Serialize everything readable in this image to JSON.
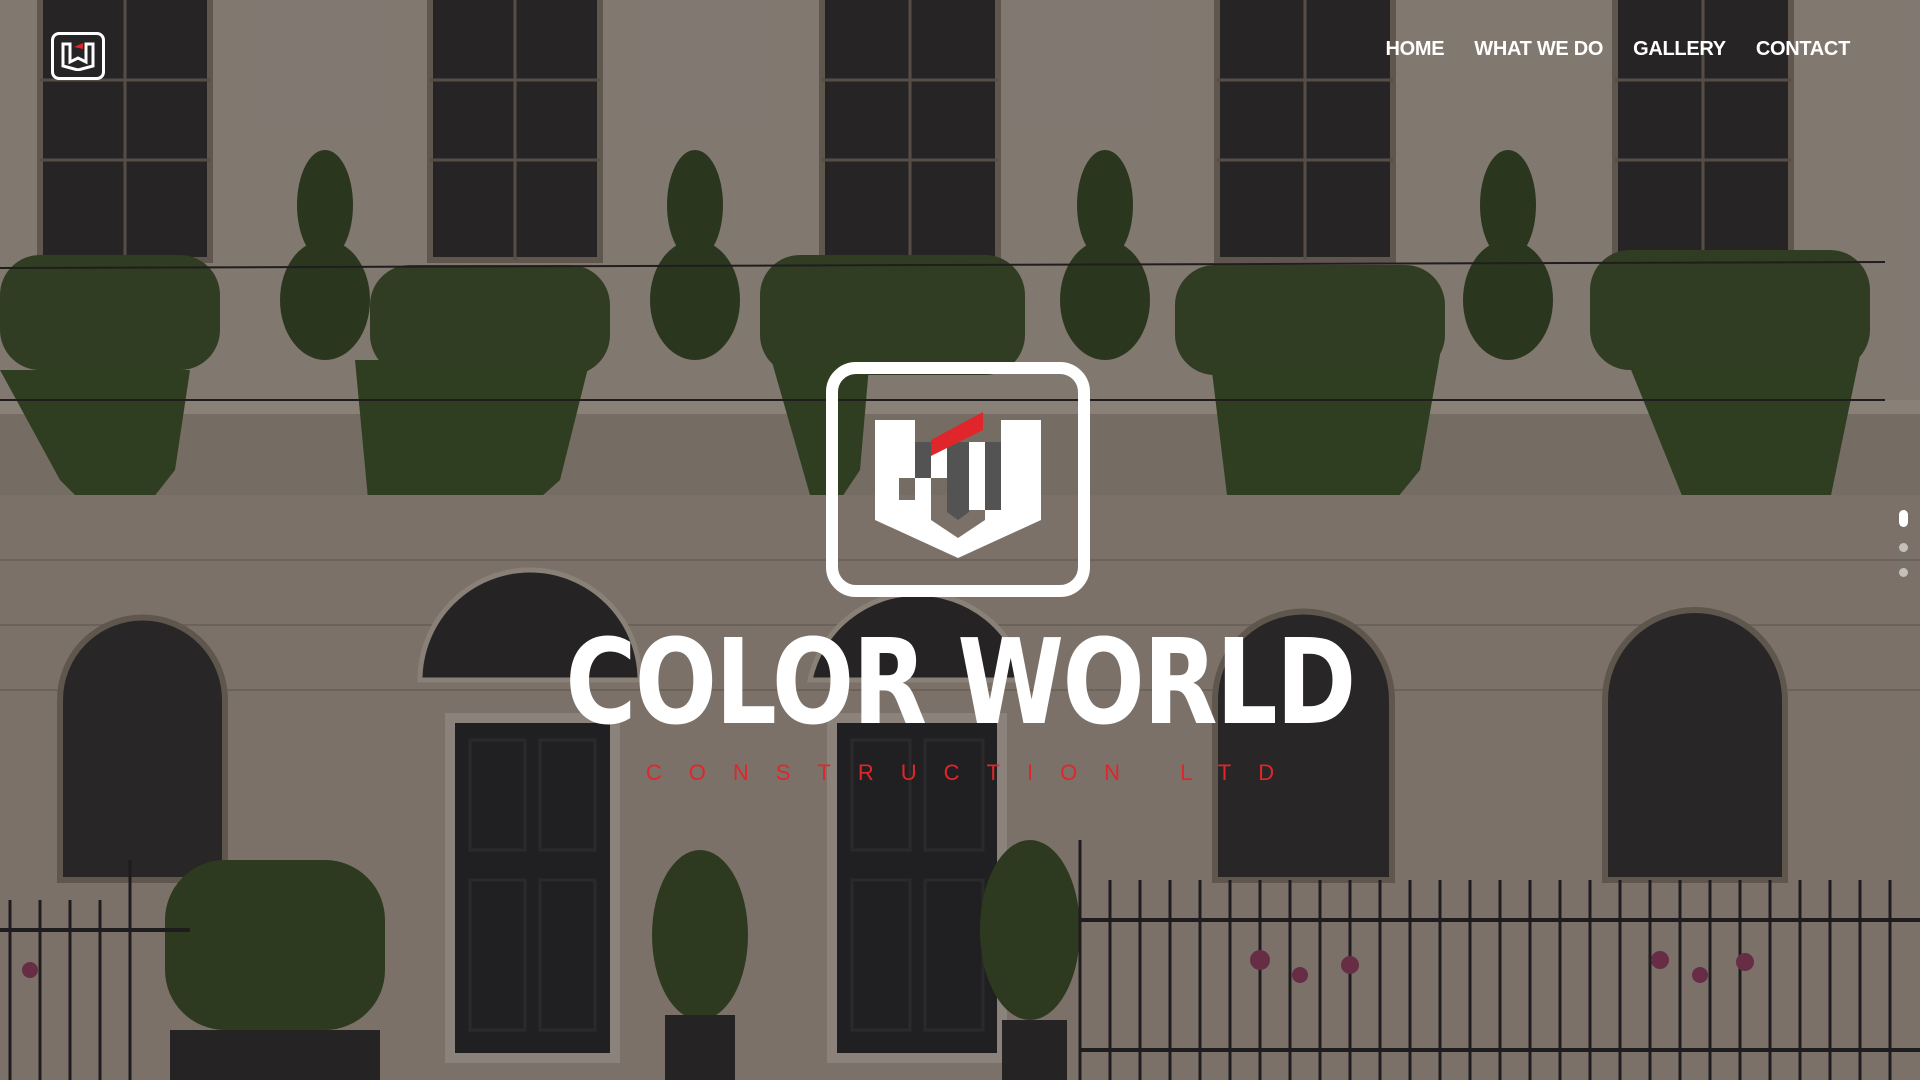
{
  "nav": {
    "items": [
      {
        "label": "HOME"
      },
      {
        "label": "WHAT WE DO"
      },
      {
        "label": "GALLERY"
      },
      {
        "label": "CONTACT"
      }
    ]
  },
  "brand": {
    "name": "COLOR WORLD",
    "tagline": "CONSTRUCTION LTD",
    "logo_icon": "cw-logo-icon",
    "accent_color": "#e0262b"
  },
  "slider": {
    "total_slides": 3,
    "active_slide": 1
  },
  "background": {
    "icon": "georgian-townhouse-facade"
  }
}
